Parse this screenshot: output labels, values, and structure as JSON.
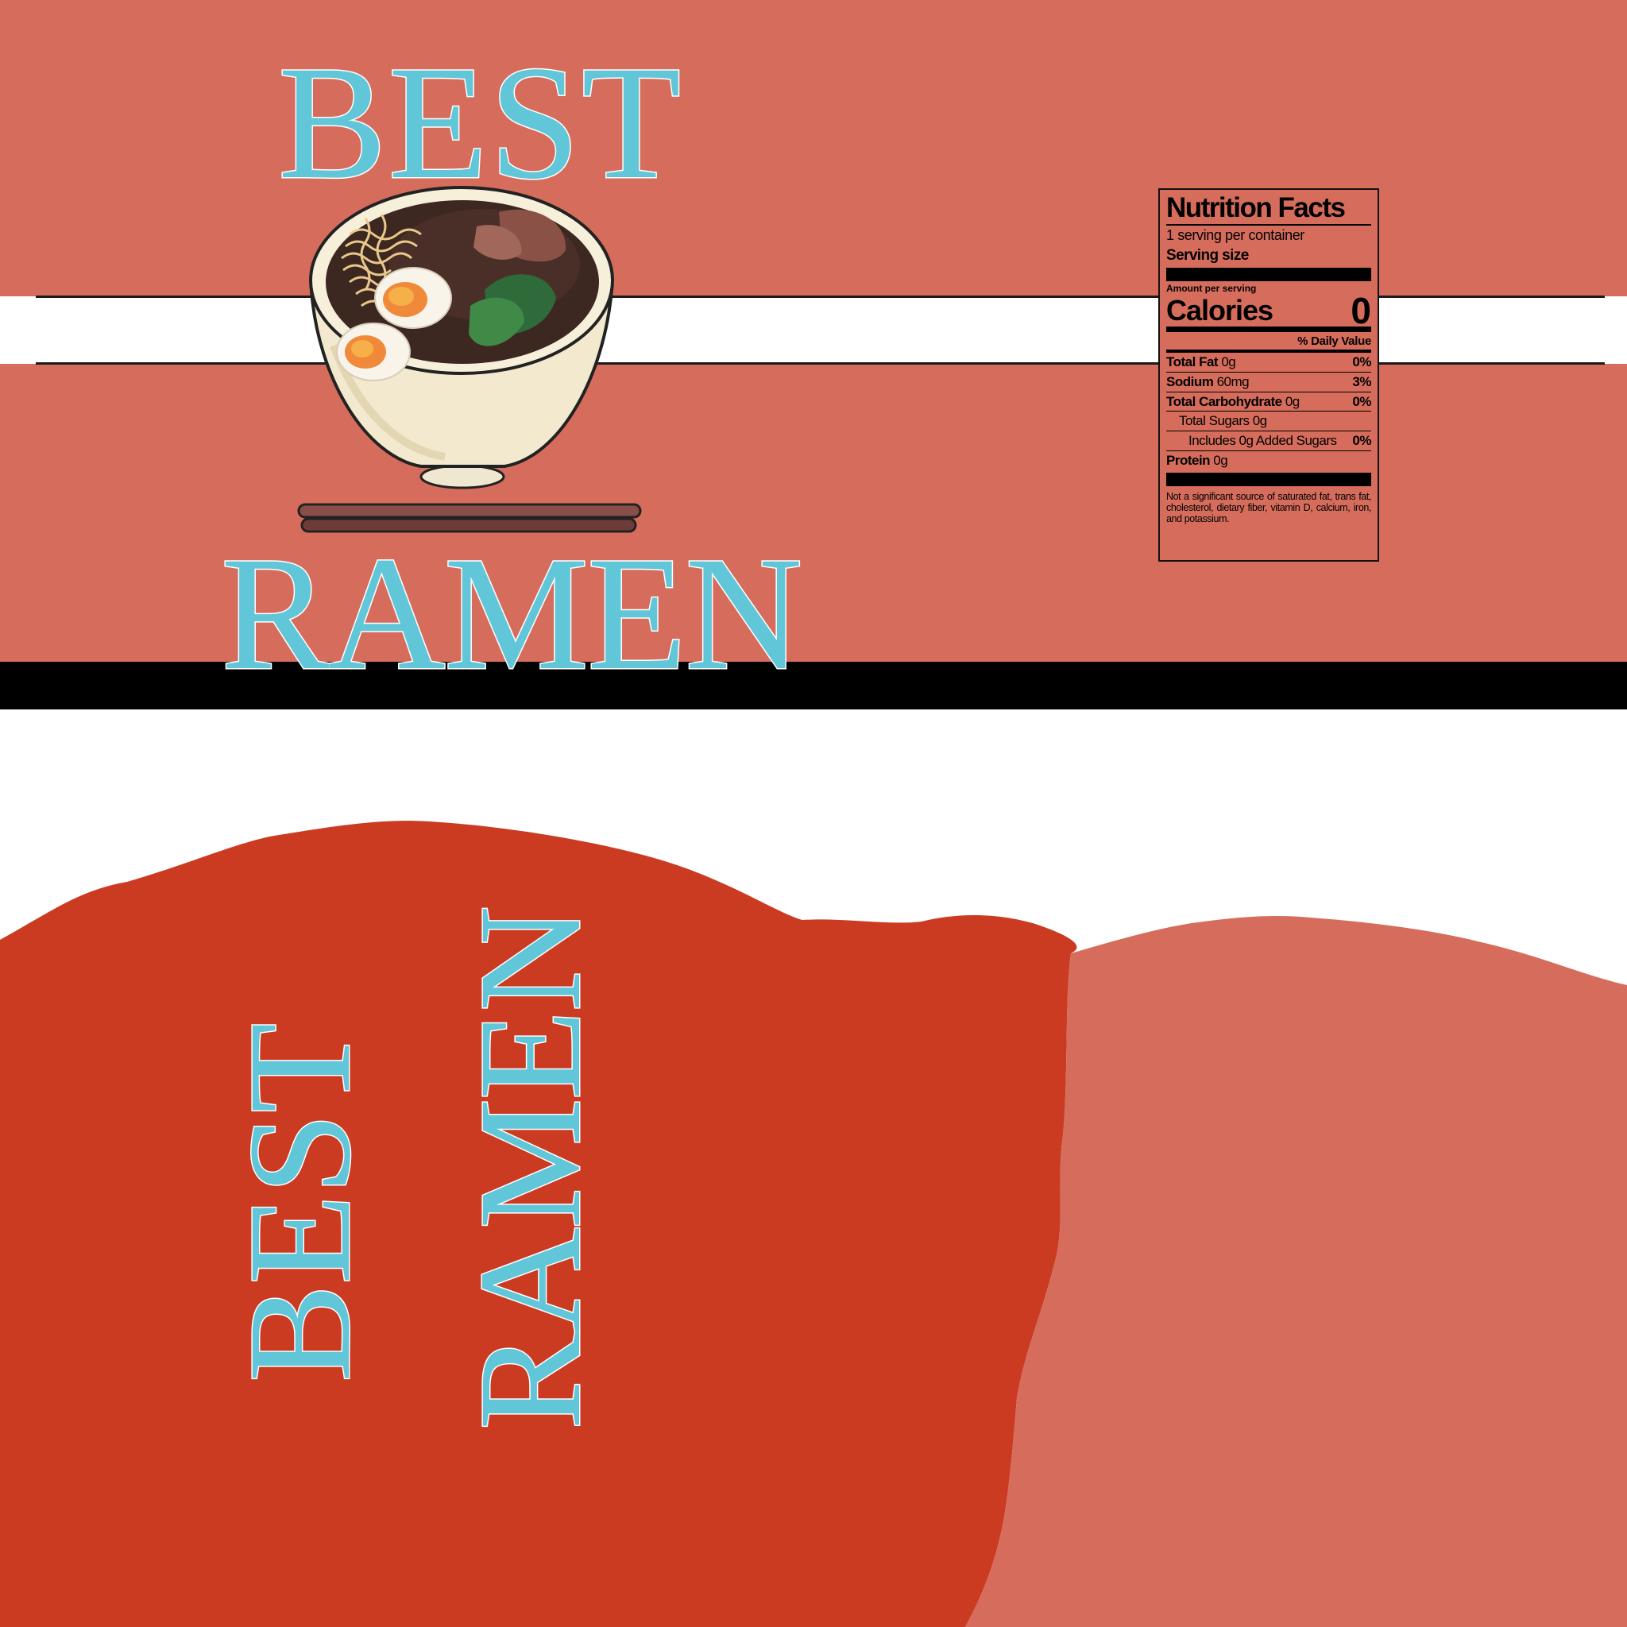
{
  "title": {
    "line1": "BEST",
    "line2": "RAMEN"
  },
  "side_title": {
    "line1": "BEST",
    "line2": "RAMEN"
  },
  "nutrition": {
    "heading": "Nutrition Facts",
    "servings_per_container": "1  serving  per container",
    "serving_size_label": "Serving size",
    "amount_per_serving": "Amount per serving",
    "calories_label": "Calories",
    "calories_value": "0",
    "daily_value_header": "% Daily Value",
    "rows": [
      {
        "name": "Total Fat",
        "amount": "0g",
        "dv": "0%"
      },
      {
        "name": "Sodium",
        "amount": "60mg",
        "dv": "3%"
      },
      {
        "name": "Total Carbohydrate",
        "amount": "0g",
        "dv": "0%"
      },
      {
        "name": "Total Sugars 0g",
        "amount": "",
        "dv": ""
      },
      {
        "name": "Includes 0g Added Sugars",
        "amount": "",
        "dv": "0%"
      },
      {
        "name": "Protein",
        "amount": "0g",
        "dv": ""
      }
    ],
    "footnote": "Not a significant source of saturated fat, trans fat, cholesterol, dietary fiber, vitamin D, calcium, iron, and potassium."
  },
  "colors": {
    "label_band": "#d66d5c",
    "deep_red": "#cb3b22",
    "salmon": "#d66d5c",
    "title_blue": "#62c6d9",
    "stripe_black": "#000000"
  },
  "icons": [
    "ramen-bowl-icon",
    "chopsticks-icon"
  ]
}
